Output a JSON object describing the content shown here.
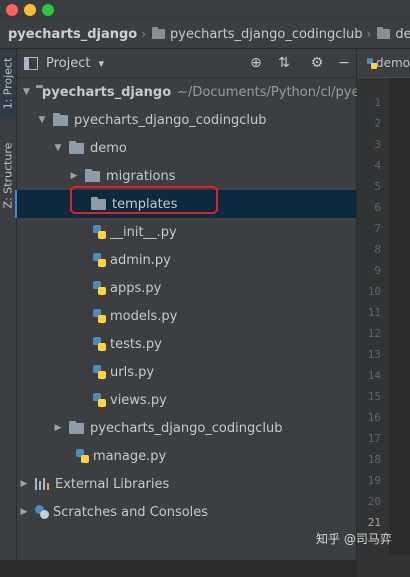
{
  "breadcrumbs": [
    {
      "label": "pyecharts_django",
      "bold": true
    },
    {
      "label": "pyecharts_django_codingclub",
      "bold": false
    },
    {
      "label": "demo",
      "bold": false
    },
    {
      "label": "te",
      "bold": false
    }
  ],
  "side_tabs": {
    "project": "1: Project",
    "structure": "Z: Structure"
  },
  "panel": {
    "title": "Project",
    "dropdown_glyph": "▾",
    "actions": [
      "target-icon",
      "collapse-icon",
      "gear-icon",
      "minimize-icon"
    ]
  },
  "tree": {
    "root": {
      "label": "pyecharts_django",
      "path": "~/Documents/Python/cl/pyec"
    },
    "inner": {
      "label": "pyecharts_django_codingclub"
    },
    "demo": {
      "label": "demo"
    },
    "migrations": {
      "label": "migrations"
    },
    "templates": {
      "label": "templates"
    },
    "files": [
      "__init__.py",
      "admin.py",
      "apps.py",
      "models.py",
      "tests.py",
      "urls.py",
      "views.py"
    ],
    "sibling": {
      "label": "pyecharts_django_codingclub"
    },
    "manage": {
      "label": "manage.py"
    },
    "libraries": {
      "label": "External Libraries"
    },
    "scratches": {
      "label": "Scratches and Consoles"
    }
  },
  "editor": {
    "tab_label": "demo",
    "line_numbers": [
      "1",
      "2",
      "3",
      "4",
      "5",
      "6",
      "7",
      "8",
      "9",
      "10",
      "11",
      "12",
      "13",
      "14",
      "15",
      "16",
      "17",
      "18",
      "19",
      "20",
      "21"
    ],
    "current_line": "21"
  },
  "watermark": "知乎 @司马弈",
  "colors": {
    "highlight_box": "#e0202c",
    "selection": "#0d293e",
    "folder": "#8f9ba6"
  }
}
